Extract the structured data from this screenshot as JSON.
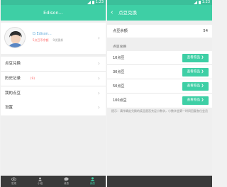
{
  "status": {
    "time": "1:23"
  },
  "left": {
    "title": "Edison...",
    "profile": {
      "name": "D.Edison...",
      "flowers": "5点豆币余额",
      "coupon": "0优惠券"
    },
    "items": [
      {
        "label": "点豆兑换",
        "badge": ""
      },
      {
        "label": "历史记录",
        "badge": "(9)"
      },
      {
        "label": "我的点豆",
        "badge": ""
      }
    ],
    "settings": {
      "label": "设置"
    },
    "tabs": [
      {
        "label": "发现"
      },
      {
        "label": "小组"
      },
      {
        "label": "消息"
      },
      {
        "label": "我的"
      }
    ]
  },
  "right": {
    "title": "点豆兑换",
    "balance_label": "点豆余额",
    "balance_value": "54",
    "section": "点豆兑换",
    "options": [
      {
        "label": "10点豆",
        "button": "查看卷品 ❯"
      },
      {
        "label": "30点豆",
        "button": "查看卷品 ❯"
      },
      {
        "label": "50点豆",
        "button": "查看卷品 ❯"
      },
      {
        "label": "100点豆",
        "button": "查看卷品 ❯"
      }
    ],
    "tip": "提示：请作确定兑换的奖品是否充足小数字，小数字会第一时间回复各位会员"
  },
  "colors": {
    "accent": "#3ecfa5",
    "accent_dark": "#3bbf9a",
    "badge": "#ff6f6f",
    "name": "#5fa8d8",
    "tabbar": "#3a3a3a"
  },
  "icons": [
    "back-icon",
    "signal-icon",
    "battery-icon",
    "chevron-right-icon",
    "avatar",
    "discover-icon",
    "group-icon",
    "message-icon",
    "me-icon"
  ]
}
